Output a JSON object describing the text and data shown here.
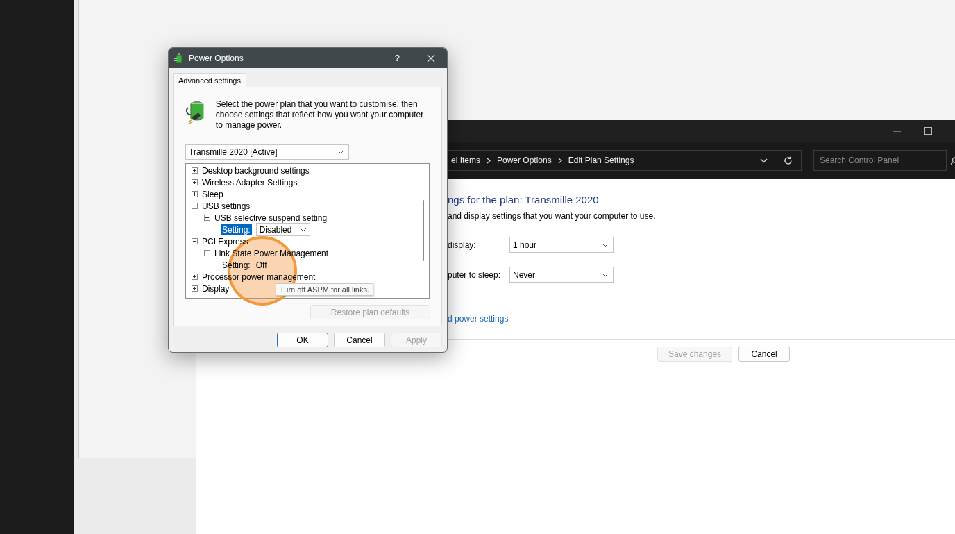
{
  "control_panel": {
    "breadcrumb": [
      "el Items",
      "Power Options",
      "Edit Plan Settings"
    ],
    "search": {
      "placeholder": "Search Control Panel"
    },
    "heading": "ngs for the plan: Transmille 2020",
    "description": "and display settings that you want your computer to use.",
    "settings": [
      {
        "label": "display:",
        "value": "1 hour"
      },
      {
        "label": "puter to sleep:",
        "value": "Never"
      }
    ],
    "link": "d power settings",
    "buttons": [
      {
        "label": "Save changes",
        "disabled": true
      },
      {
        "label": "Cancel",
        "disabled": false
      }
    ]
  },
  "dialog": {
    "title": "Power Options",
    "help": "?",
    "tabs": [
      {
        "label": "Advanced settings",
        "selected": true
      }
    ],
    "intro": "Select the power plan that you want to customise, then choose settings that reflect how you want your computer to manage power.",
    "plan": "Transmille 2020 [Active]",
    "tree": [
      {
        "kind": "group",
        "label": "Desktop background settings",
        "expanded": false
      },
      {
        "kind": "group",
        "label": "Wireless Adapter Settings",
        "expanded": false
      },
      {
        "kind": "group",
        "label": "Sleep",
        "expanded": false
      },
      {
        "kind": "group",
        "label": "USB settings",
        "expanded": true,
        "children": [
          {
            "kind": "group",
            "label": "USB selective suspend setting",
            "expanded": true,
            "children": [
              {
                "kind": "setting_dropdown",
                "label": "Setting:",
                "value": "Disabled",
                "selected": true
              }
            ]
          }
        ]
      },
      {
        "kind": "group",
        "label": "PCI Express",
        "expanded": true,
        "children": [
          {
            "kind": "group",
            "label": "Link State Power Management",
            "expanded": true,
            "children": [
              {
                "kind": "setting_text",
                "label": "Setting:",
                "value": "Off",
                "selected": false
              }
            ]
          }
        ]
      },
      {
        "kind": "group",
        "label": "Processor power management",
        "expanded": false
      },
      {
        "kind": "group",
        "label": "Display",
        "expanded": false
      }
    ],
    "tooltip": "Turn off ASPM for all links.",
    "restore_button": {
      "label": "Restore plan defaults",
      "disabled": true
    },
    "buttons": [
      {
        "label": "OK",
        "default": true,
        "disabled": false
      },
      {
        "label": "Cancel",
        "default": false,
        "disabled": false
      },
      {
        "label": "Apply",
        "default": false,
        "disabled": true
      }
    ]
  }
}
